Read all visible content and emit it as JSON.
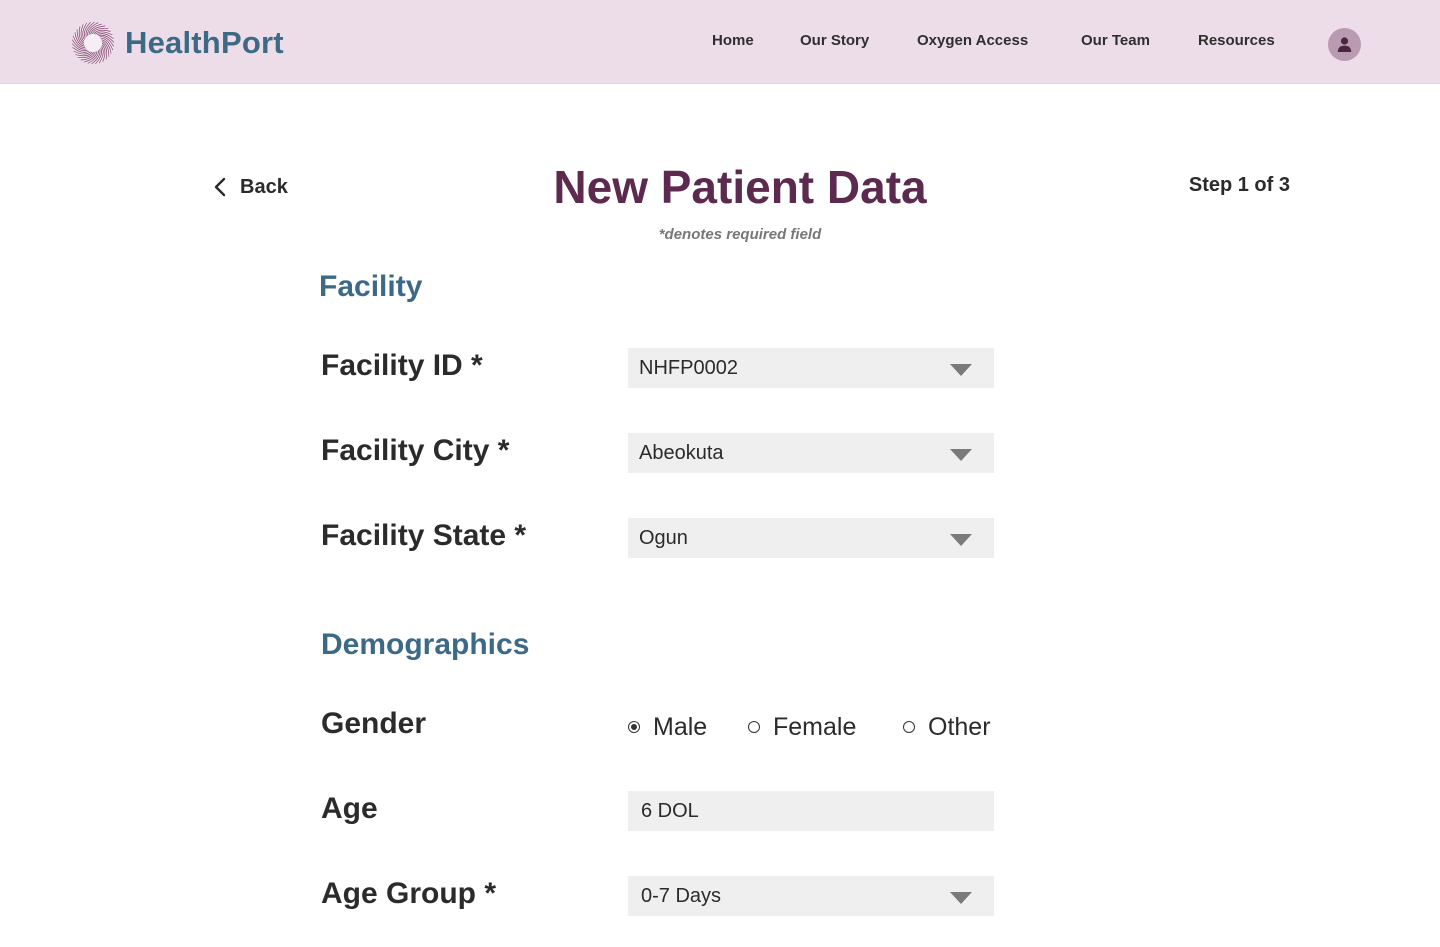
{
  "header": {
    "logo_text": "HealthPort",
    "nav": [
      "Home",
      "Our Story",
      "Oxygen Access",
      "Our Team",
      "Resources"
    ]
  },
  "page": {
    "back_label": "Back",
    "title": "New Patient Data",
    "step": "Step 1 of 3",
    "required_note": "*denotes required field"
  },
  "sections": {
    "facility": "Facility",
    "demographics": "Demographics"
  },
  "fields": {
    "facility_id": {
      "label": "Facility ID *",
      "value": "NHFP0002"
    },
    "facility_city": {
      "label": "Facility City *",
      "value": "Abeokuta"
    },
    "facility_state": {
      "label": "Facility State *",
      "value": "Ogun"
    },
    "gender": {
      "label": "Gender",
      "options": [
        "Male",
        "Female",
        "Other"
      ],
      "selected": "Male"
    },
    "age": {
      "label": "Age",
      "value": "6 DOL"
    },
    "age_group": {
      "label": "Age Group *",
      "value": "0-7 Days"
    }
  },
  "icons": {
    "logo": "spiral-logo-icon",
    "user": "user-icon",
    "back": "chevron-left-icon",
    "dropdown": "caret-down-icon"
  },
  "colors": {
    "header_bg": "#ecdde8",
    "brand_blue": "#3c6a86",
    "title_plum": "#5c2a4f",
    "field_bg": "#efefef",
    "avatar": "#b99ab0"
  }
}
